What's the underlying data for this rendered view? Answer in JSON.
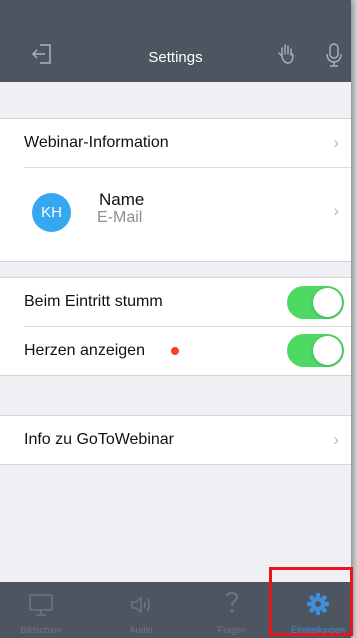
{
  "navbar": {
    "title": "Settings",
    "left_icon": "exit-icon",
    "right_icons": [
      "raise-hand-icon",
      "microphone-icon"
    ]
  },
  "webinar_info": {
    "label": "Webinar-Information"
  },
  "user": {
    "initials": "KH",
    "name": "Name",
    "email": "E-Mail"
  },
  "toggles": [
    {
      "label": "Beim Eintritt stumm",
      "on": true
    },
    {
      "label": "Herzen anzeigen",
      "on": true,
      "indicator": "red-dot"
    }
  ],
  "about": {
    "label": "Info zu GoToWebinar"
  },
  "tabs": [
    {
      "label": "Bildschirm",
      "icon": "monitor-icon",
      "active": false
    },
    {
      "label": "Audio",
      "icon": "speaker-icon",
      "active": false
    },
    {
      "label": "Fragen",
      "icon": "question-icon",
      "active": false
    },
    {
      "label": "Einstellungen",
      "icon": "gear-icon",
      "active": true
    }
  ],
  "colors": {
    "navbar": "#4d5560",
    "toggle_on": "#4cd964",
    "accent": "#3f8fdb",
    "avatar": "#36a8f2",
    "highlight": "#e8151b"
  }
}
